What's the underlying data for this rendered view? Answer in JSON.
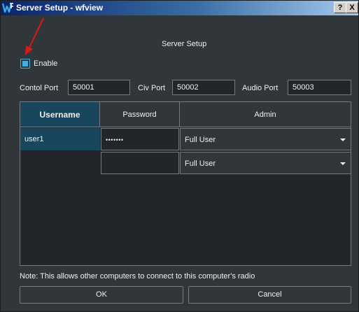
{
  "window": {
    "title": "Server Setup - wfview",
    "help_label": "?",
    "close_label": "X"
  },
  "header": {
    "heading": "Server Setup"
  },
  "enable": {
    "label": "Enable",
    "checked": true
  },
  "ports": {
    "control_label": "Contol Port",
    "control_value": "50001",
    "civ_label": "Civ Port",
    "civ_value": "50002",
    "audio_label": "Audio Port",
    "audio_value": "50003"
  },
  "users_table": {
    "columns": [
      "Username",
      "Password",
      "Admin"
    ],
    "rows": [
      {
        "username": "user1",
        "password": "•••••••",
        "admin": "Full User"
      },
      {
        "username": "",
        "password": "",
        "admin": "Full User"
      }
    ]
  },
  "note": "Note: This allows other computers to connect to this computer's radio",
  "buttons": {
    "ok": "OK",
    "cancel": "Cancel"
  },
  "colors": {
    "background": "#31363b",
    "accent": "#3daee9",
    "selection": "#18465d",
    "annotation_arrow": "#e01818"
  }
}
